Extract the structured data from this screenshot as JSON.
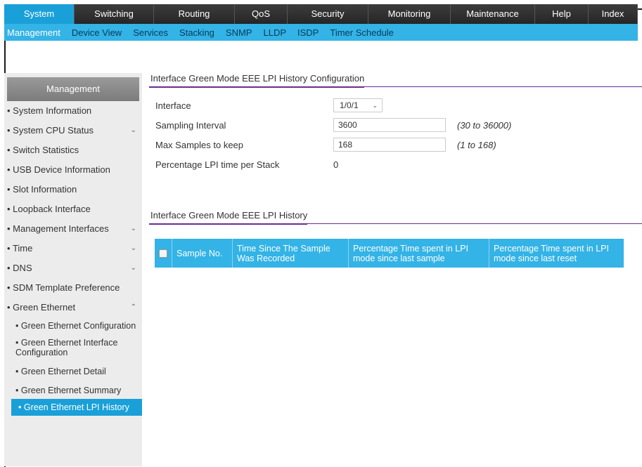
{
  "main_nav": [
    {
      "label": "System",
      "active": true
    },
    {
      "label": "Switching"
    },
    {
      "label": "Routing"
    },
    {
      "label": "QoS"
    },
    {
      "label": "Security"
    },
    {
      "label": "Monitoring"
    },
    {
      "label": "Maintenance"
    },
    {
      "label": "Help"
    },
    {
      "label": "Index"
    }
  ],
  "sub_nav": [
    {
      "label": "Management",
      "active": true
    },
    {
      "label": "Device View"
    },
    {
      "label": "Services"
    },
    {
      "label": "Stacking"
    },
    {
      "label": "SNMP"
    },
    {
      "label": "LLDP"
    },
    {
      "label": "ISDP"
    },
    {
      "label": "Timer Schedule"
    }
  ],
  "sidebar": {
    "header": "Management",
    "items": [
      {
        "label": "System Information"
      },
      {
        "label": "System CPU Status",
        "chevron": "down"
      },
      {
        "label": "Switch Statistics"
      },
      {
        "label": "USB Device Information"
      },
      {
        "label": "Slot Information"
      },
      {
        "label": "Loopback Interface"
      },
      {
        "label": "Management Interfaces",
        "chevron": "down"
      },
      {
        "label": "Time",
        "chevron": "down"
      },
      {
        "label": "DNS",
        "chevron": "down"
      },
      {
        "label": "SDM Template Preference"
      },
      {
        "label": "Green Ethernet",
        "chevron": "up"
      }
    ],
    "sub_items": [
      {
        "label": "Green Ethernet Configuration"
      },
      {
        "label": "Green Ethernet Interface Configuration"
      },
      {
        "label": "Green Ethernet Detail"
      },
      {
        "label": "Green Ethernet Summary"
      },
      {
        "label": "Green Ethernet LPI History",
        "active": true
      }
    ]
  },
  "config": {
    "title": "Interface Green Mode EEE LPI History Configuration",
    "interface_label": "Interface",
    "interface_value": "1/0/1",
    "sampling_label": "Sampling Interval",
    "sampling_value": "3600",
    "sampling_range": "(30 to 36000)",
    "max_label": "Max Samples to keep",
    "max_value": "168",
    "max_range": "(1 to 168)",
    "pct_label": "Percentage LPI time per Stack",
    "pct_value": "0"
  },
  "history": {
    "title": "Interface Green Mode EEE LPI History",
    "columns": [
      "Sample No.",
      "Time Since The Sample Was Recorded",
      "Percentage Time spent in LPI mode since last sample",
      "Percentage Time spent in LPI mode since last reset"
    ]
  },
  "colors": {
    "accent": "#1aa0d8",
    "subnav": "#33b3e6",
    "section_line": "#6a2c91"
  }
}
